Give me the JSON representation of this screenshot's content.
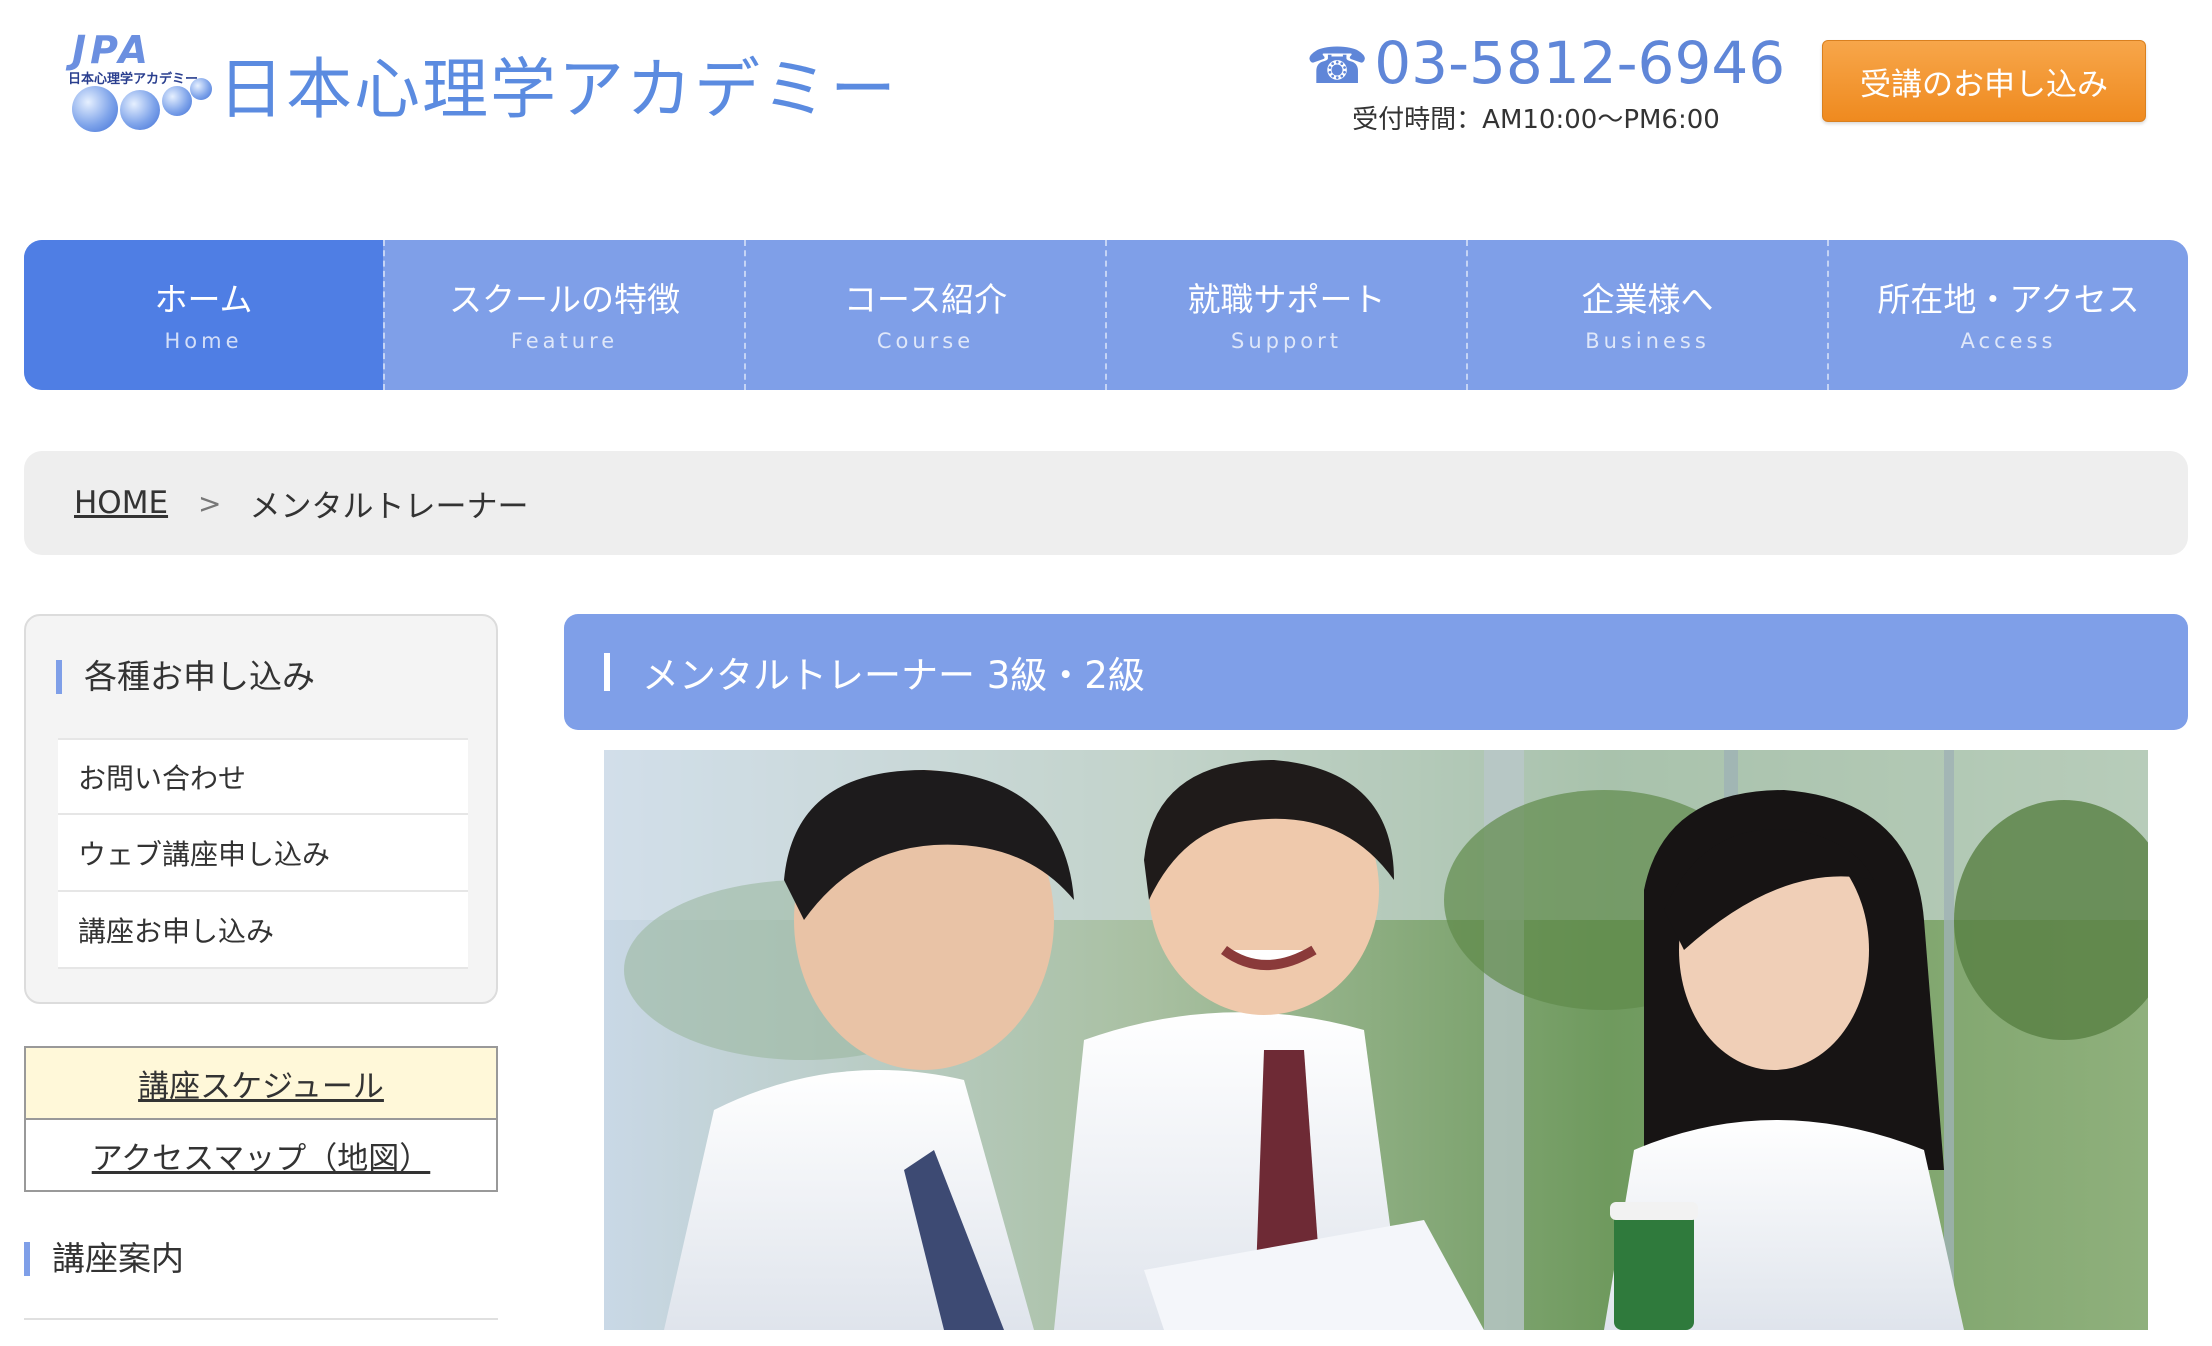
{
  "header": {
    "logo_mark": "JPA",
    "logo_small": "日本心理学アカデミー",
    "logo_text": "日本心理学アカデミー",
    "phone_icon": "☎",
    "phone_number": "03-5812-6946",
    "phone_hours": "受付時間：AM10:00〜PM6:00",
    "apply_button": "受講のお申し込み"
  },
  "nav": {
    "items": [
      {
        "ja": "ホーム",
        "en": "Home"
      },
      {
        "ja": "スクールの特徴",
        "en": "Feature"
      },
      {
        "ja": "コース紹介",
        "en": "Course"
      },
      {
        "ja": "就職サポート",
        "en": "Support"
      },
      {
        "ja": "企業様へ",
        "en": "Business"
      },
      {
        "ja": "所在地・アクセス",
        "en": "Access"
      }
    ]
  },
  "breadcrumb": {
    "home": "HOME",
    "separator": ">",
    "current": "メンタルトレーナー"
  },
  "sidebar": {
    "heading": "各種お申し込み",
    "items": [
      "お問い合わせ",
      "ウェブ講座申し込み",
      "講座お申し込み"
    ],
    "links": [
      "講座スケジュール",
      "アクセスマップ（地図）"
    ],
    "heading2": "講座案内"
  },
  "main": {
    "title": "メンタルトレーナー 3級・2級"
  },
  "colors": {
    "nav": "#7f9fe8",
    "nav_active": "#4f7ee4",
    "accent_orange": "#ef8a1f",
    "brand_blue": "#5b8be0"
  }
}
